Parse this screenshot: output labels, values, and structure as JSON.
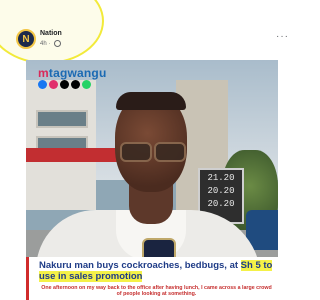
{
  "post": {
    "avatar_letter": "N",
    "page_name": "Nation",
    "meta": "4h ·",
    "more_label": "···"
  },
  "image": {
    "brand_prefix": "m",
    "brand_rest": "tagwangu",
    "price_lines": [
      "21.20",
      "20.20",
      "20.20"
    ],
    "social_colors": [
      "#1877f2",
      "#e1306c",
      "#000000",
      "#000000",
      "#25d366"
    ]
  },
  "caption": {
    "headline_part1": "Nakuru man buys cockroaches, bedbugs, at ",
    "headline_highlight": "Sh 5 to use in sales promotion",
    "subhead": "One afternoon on my way back to the office after having lunch, I came across a large crowd of people looking at something."
  },
  "colors": {
    "highlight_ring": "#f2ea3a",
    "headline_text": "#1f3c87",
    "headline_highlight_bg": "#f4f148",
    "subhead_text": "#c62f2f"
  }
}
